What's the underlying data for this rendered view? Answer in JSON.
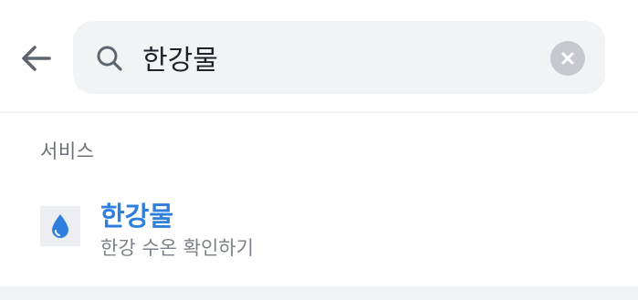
{
  "header": {
    "back_icon": "arrow-left-icon",
    "search": {
      "icon": "search-icon",
      "value": "한강물",
      "clear_icon": "close-icon"
    }
  },
  "section": {
    "label": "서비스"
  },
  "results": [
    {
      "icon": "water-drop-icon",
      "title": "한강물",
      "subtitle": "한강 수온 확인하기"
    }
  ],
  "colors": {
    "accent": "#2f7fde",
    "search_bg": "#f2f3f5",
    "text_secondary": "#7c8189"
  }
}
